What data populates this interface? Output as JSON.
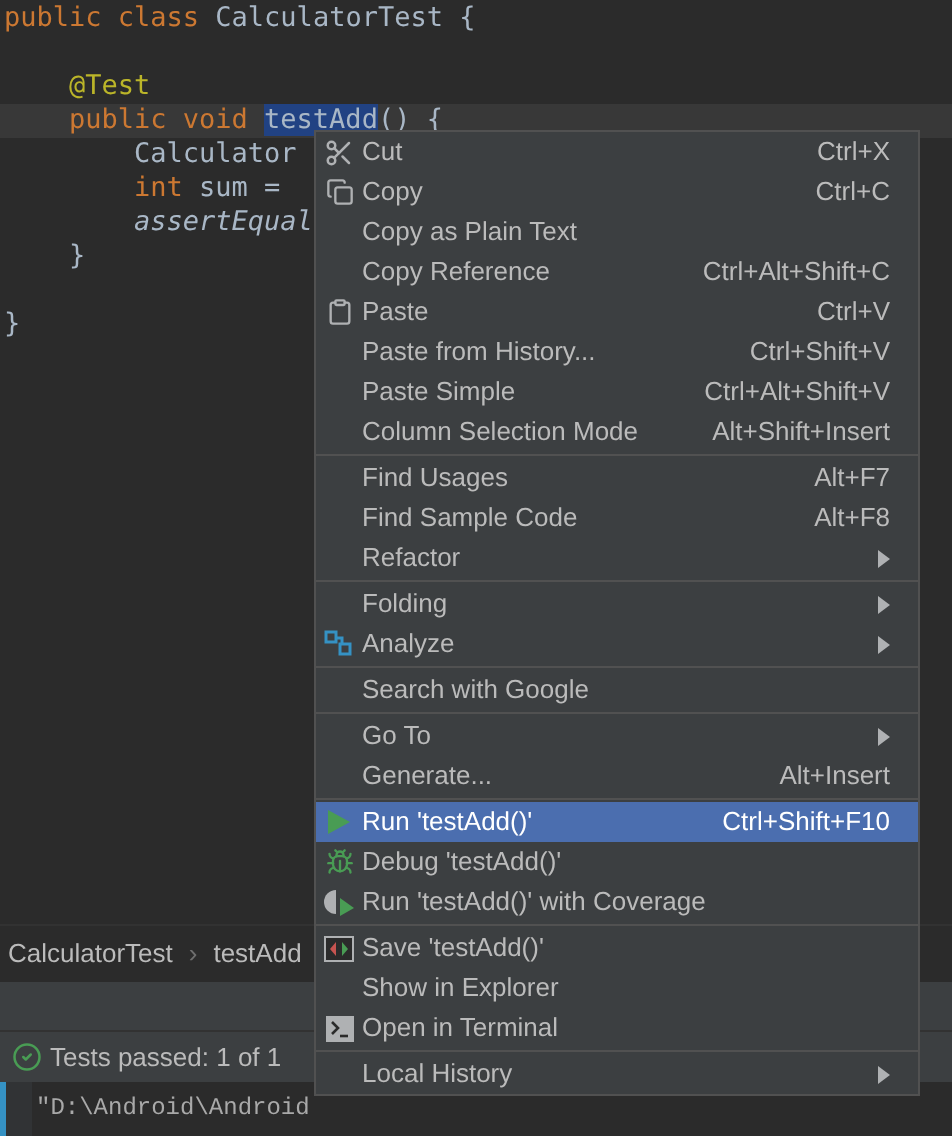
{
  "editor": {
    "lines": [
      {
        "current": false,
        "tokens": [
          {
            "kind": "keyword",
            "text": "public class "
          },
          {
            "kind": "plain",
            "text": "CalculatorTest {"
          }
        ]
      },
      {
        "current": false
      },
      {
        "current": false,
        "tokens": [
          {
            "kind": "annotation",
            "text": "    @Test"
          }
        ]
      },
      {
        "current": true,
        "tokens": [
          {
            "kind": "keyword",
            "text": "    public void "
          },
          {
            "kind": "selected",
            "text": "testAdd"
          },
          {
            "kind": "plain",
            "text": "() {"
          }
        ]
      },
      {
        "current": false,
        "tokens": [
          {
            "kind": "plain",
            "text": "        Calculator"
          }
        ]
      },
      {
        "current": false,
        "tokens": [
          {
            "kind": "keyword",
            "text": "        int "
          },
          {
            "kind": "plain",
            "text": "sum ="
          }
        ]
      },
      {
        "current": false,
        "tokens": [
          {
            "kind": "italic",
            "text": "        assertEqual"
          }
        ]
      },
      {
        "current": false,
        "tokens": [
          {
            "kind": "plain",
            "text": "    }"
          }
        ]
      },
      {
        "current": false
      },
      {
        "current": false,
        "tokens": [
          {
            "kind": "plain",
            "text": "}"
          }
        ]
      }
    ]
  },
  "breadcrumbs": {
    "items": [
      "CalculatorTest",
      "testAdd"
    ],
    "separator": "›"
  },
  "test_status": {
    "text": "Tests passed: 1 of 1"
  },
  "console": {
    "line": "\"D:\\Android\\Android"
  },
  "context_menu": {
    "groups": [
      [
        {
          "label": "Cut",
          "shortcut": "Ctrl+X",
          "submenu": false,
          "selected": false
        },
        {
          "label": "Copy",
          "shortcut": "Ctrl+C",
          "submenu": false,
          "selected": false
        },
        {
          "label": "Copy as Plain Text",
          "submenu": false,
          "selected": false
        },
        {
          "label": "Copy Reference",
          "shortcut": "Ctrl+Alt+Shift+C",
          "submenu": false,
          "selected": false
        },
        {
          "label": "Paste",
          "shortcut": "Ctrl+V",
          "submenu": false,
          "selected": false
        },
        {
          "label": "Paste from History...",
          "shortcut": "Ctrl+Shift+V",
          "submenu": false,
          "selected": false
        },
        {
          "label": "Paste Simple",
          "shortcut": "Ctrl+Alt+Shift+V",
          "submenu": false,
          "selected": false
        },
        {
          "label": "Column Selection Mode",
          "shortcut": "Alt+Shift+Insert",
          "submenu": false,
          "selected": false
        }
      ],
      [
        {
          "label": "Find Usages",
          "shortcut": "Alt+F7",
          "submenu": false,
          "selected": false
        },
        {
          "label": "Find Sample Code",
          "shortcut": "Alt+F8",
          "submenu": false,
          "selected": false
        },
        {
          "label": "Refactor",
          "submenu": true,
          "selected": false
        }
      ],
      [
        {
          "label": "Folding",
          "submenu": true,
          "selected": false
        },
        {
          "label": "Analyze",
          "submenu": true,
          "selected": false
        }
      ],
      [
        {
          "label": "Search with Google",
          "submenu": false,
          "selected": false
        }
      ],
      [
        {
          "label": "Go To",
          "submenu": true,
          "selected": false
        },
        {
          "label": "Generate...",
          "shortcut": "Alt+Insert",
          "submenu": false,
          "selected": false
        }
      ],
      [
        {
          "label": "Run 'testAdd()'",
          "shortcut": "Ctrl+Shift+F10",
          "submenu": false,
          "selected": true
        },
        {
          "label": "Debug 'testAdd()'",
          "submenu": false,
          "selected": false
        },
        {
          "label": "Run 'testAdd()' with Coverage",
          "submenu": false,
          "selected": false
        }
      ],
      [
        {
          "label": "Save 'testAdd()'",
          "submenu": false,
          "selected": false
        },
        {
          "label": "Show in Explorer",
          "submenu": false,
          "selected": false
        },
        {
          "label": "Open in Terminal",
          "submenu": false,
          "selected": false
        }
      ],
      [
        {
          "label": "Local History",
          "submenu": true,
          "selected": false
        }
      ]
    ]
  }
}
